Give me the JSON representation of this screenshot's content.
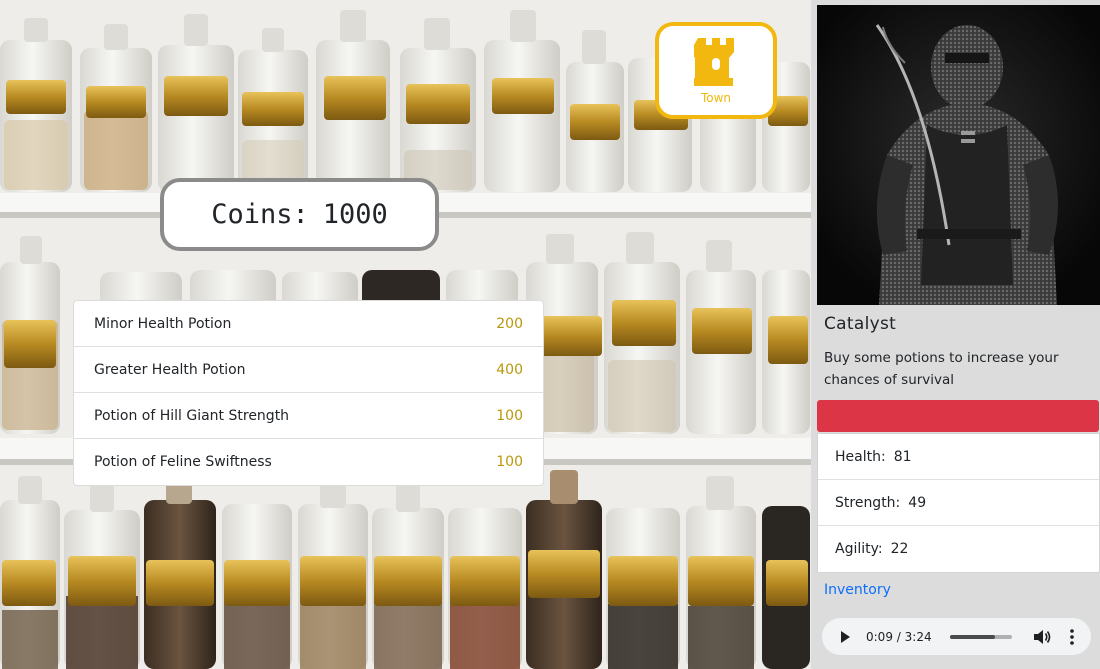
{
  "town": {
    "label": "Town",
    "icon": "castle-tower-icon",
    "color": "#f2b810"
  },
  "coins": {
    "label": "Coins:",
    "value": "1000"
  },
  "shop": {
    "items": [
      {
        "name": "Minor Health Potion",
        "price": "200"
      },
      {
        "name": "Greater Health Potion",
        "price": "400"
      },
      {
        "name": "Potion of Hill Giant Strength",
        "price": "100"
      },
      {
        "name": "Potion of Feline Swiftness",
        "price": "100"
      }
    ],
    "price_color": "#b8980e"
  },
  "character": {
    "name": "Catalyst",
    "description": "Buy some potions to increase your chances of survival",
    "portrait_icon": "armored-warrior-portrait",
    "health_bar_color": "#dc3545",
    "stats": [
      {
        "label": "Health:",
        "value": "81"
      },
      {
        "label": "Strength:",
        "value": "49"
      },
      {
        "label": "Agility:",
        "value": "22"
      }
    ]
  },
  "inventory": {
    "label": "Inventory"
  },
  "audio": {
    "current": "0:09",
    "duration": "3:24",
    "progress": 0.73
  },
  "background": {
    "scene": "apothecary-shelves-with-glass-bottles"
  }
}
